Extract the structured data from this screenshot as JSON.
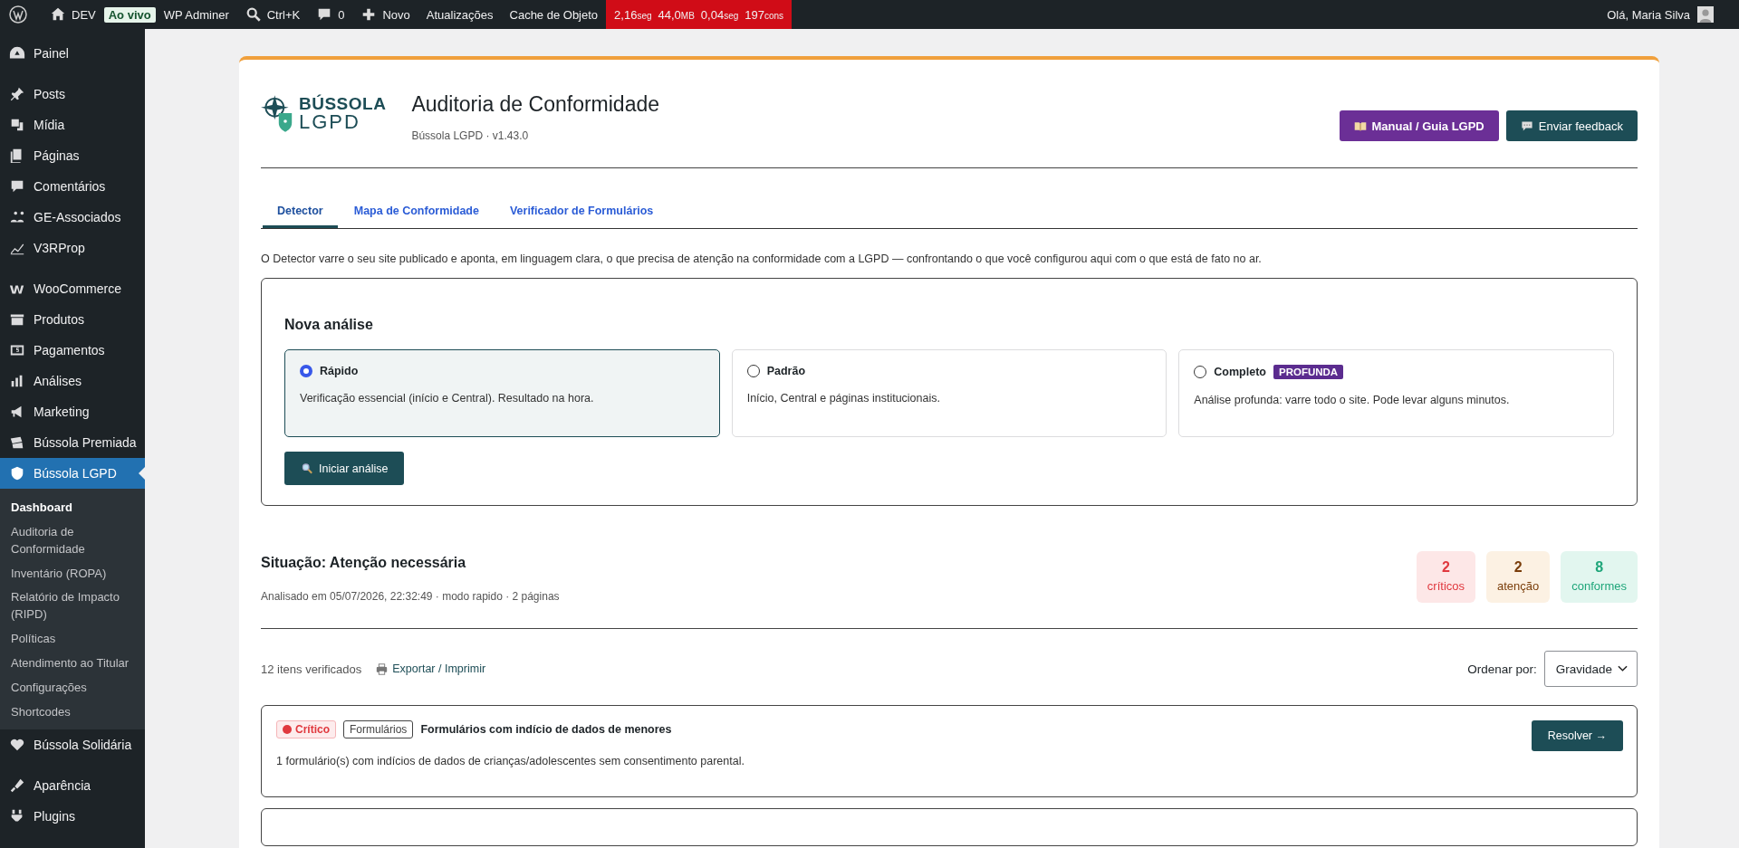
{
  "admin_bar": {
    "site": "DEV",
    "live_badge": "Ao vivo",
    "adminer": "WP Adminer",
    "search_shortcut": "Ctrl+K",
    "comments": "0",
    "new": "Novo",
    "updates": "Atualizações",
    "cache": "Cache de Objeto",
    "perf": [
      {
        "value": "2,16",
        "unit": "seg"
      },
      {
        "value": "44,0",
        "unit": "MB"
      },
      {
        "value": "0,04",
        "unit": "seg"
      },
      {
        "value": "197",
        "unit": "cons"
      }
    ],
    "greeting": "Olá, Maria Silva"
  },
  "sidebar": {
    "groups": [
      {
        "items": [
          {
            "label": "Painel",
            "selected": false
          }
        ]
      },
      {
        "items": [
          {
            "label": "Posts",
            "selected": false
          },
          {
            "label": "Mídia",
            "selected": false
          },
          {
            "label": "Páginas",
            "selected": false
          },
          {
            "label": "Comentários",
            "selected": false
          },
          {
            "label": "GE-Associados",
            "selected": false
          },
          {
            "label": "V3RProp",
            "selected": false
          }
        ]
      },
      {
        "items": [
          {
            "label": "WooCommerce",
            "selected": false
          },
          {
            "label": "Produtos",
            "selected": false
          },
          {
            "label": "Pagamentos",
            "selected": false
          },
          {
            "label": "Análises",
            "selected": false
          },
          {
            "label": "Marketing",
            "selected": false
          },
          {
            "label": "Bússola Premiada",
            "selected": false
          },
          {
            "label": "Bússola LGPD",
            "selected": true,
            "children": [
              {
                "label": "Dashboard",
                "selected": true
              },
              {
                "label": "Auditoria de Conformidade",
                "selected": false
              },
              {
                "label": "Inventário (ROPA)",
                "selected": false
              },
              {
                "label": "Relatório de Impacto (RIPD)",
                "selected": false
              },
              {
                "label": "Políticas",
                "selected": false
              },
              {
                "label": "Atendimento ao Titular",
                "selected": false
              },
              {
                "label": "Configurações",
                "selected": false
              },
              {
                "label": "Shortcodes",
                "selected": false
              }
            ]
          },
          {
            "label": "Bússola Solidária",
            "selected": false
          }
        ]
      },
      {
        "items": [
          {
            "label": "Aparência",
            "selected": false
          },
          {
            "label": "Plugins",
            "selected": false
          }
        ]
      }
    ]
  },
  "header": {
    "logo_top": "BÚSSOLA",
    "logo_bottom": "LGPD",
    "title": "Auditoria de Conformidade",
    "subtitle": "Bússola LGPD · v1.43.0",
    "buttons": [
      {
        "label": "Manual / Guia LGPD",
        "kind": "manual"
      },
      {
        "label": "Enviar feedback",
        "kind": "feedback"
      }
    ]
  },
  "tabs": [
    {
      "label": "Detector",
      "selected": true
    },
    {
      "label": "Mapa de Conformidade",
      "selected": false
    },
    {
      "label": "Verificador de Formulários",
      "selected": false
    }
  ],
  "intro": "O Detector varre o seu site publicado e aponta, em linguagem clara, o que precisa de atenção na conformidade com a LGPD — confrontando o que você configurou aqui com o que está de fato no ar.",
  "analysis": {
    "title": "Nova análise",
    "options": [
      {
        "label": "Rápido",
        "description": "Verificação essencial (início e Central). Resultado na hora.",
        "selected": true
      },
      {
        "label": "Padrão",
        "description": "Início, Central e páginas institucionais.",
        "selected": false
      },
      {
        "label": "Completo",
        "badge": "PROFUNDA",
        "description": "Análise profunda: varre todo o site. Pode levar alguns minutos.",
        "selected": false
      }
    ],
    "start_button": "Iniciar análise"
  },
  "status": {
    "title": "Situação: Atenção necessária",
    "meta": "Analisado em 05/07/2026, 22:32:49 · modo rapido · 2 páginas",
    "counts": [
      {
        "value": "2",
        "label": "críticos",
        "kind": "critical"
      },
      {
        "value": "2",
        "label": "atenção",
        "kind": "warning"
      },
      {
        "value": "8",
        "label": "conformes",
        "kind": "ok"
      }
    ]
  },
  "results": {
    "count": "12 itens verificados",
    "export": "Exportar / Imprimir",
    "sort_label": "Ordenar por:",
    "sort_value": "Gravidade",
    "items": [
      {
        "severity": "Crítico",
        "kind": "critical",
        "tag": "Formulários",
        "title": "Formulários com indício de dados de menores",
        "description": "1 formulário(s) com indícios de dados de crianças/adolescentes sem consentimento parental.",
        "action": "Resolver →"
      }
    ]
  }
}
